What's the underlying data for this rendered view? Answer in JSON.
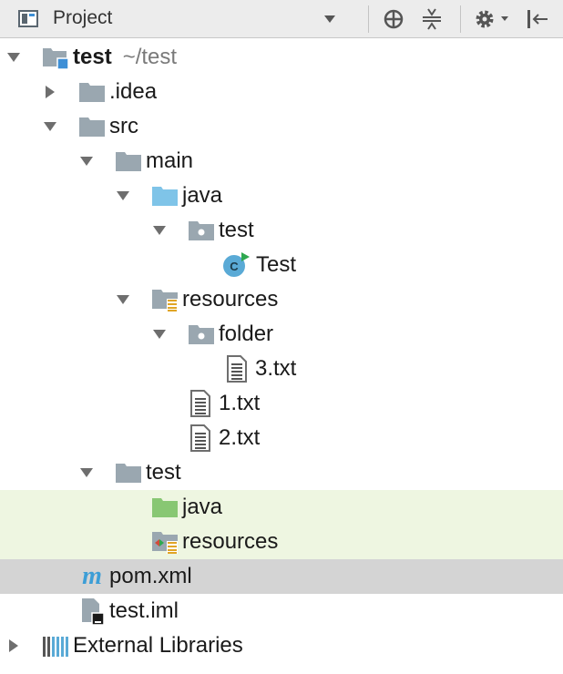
{
  "toolbar": {
    "title": "Project",
    "icons": [
      "project-view-icon",
      "dropdown-icon",
      "locate-icon",
      "collapse-all-icon",
      "settings-icon",
      "hide-icon"
    ]
  },
  "tree": {
    "root": {
      "name": "test",
      "path": "~/test"
    },
    "idea": ".idea",
    "src": "src",
    "main": "main",
    "main_java": "java",
    "main_java_test": "test",
    "test_class": "Test",
    "main_resources": "resources",
    "folder": "folder",
    "file3": "3.txt",
    "file1": "1.txt",
    "file2": "2.txt",
    "test_dir": "test",
    "test_java": "java",
    "test_resources": "resources",
    "pom": "pom.xml",
    "iml": "test.iml",
    "external": "External Libraries"
  },
  "colors": {
    "toolbar_bg": "#ececec",
    "folder_gray": "#9aa7b0",
    "folder_blue": "#7fc4e8",
    "folder_green": "#88c773",
    "test_root_bg": "#eef6e1",
    "selected_bg": "#d4d4d4"
  }
}
